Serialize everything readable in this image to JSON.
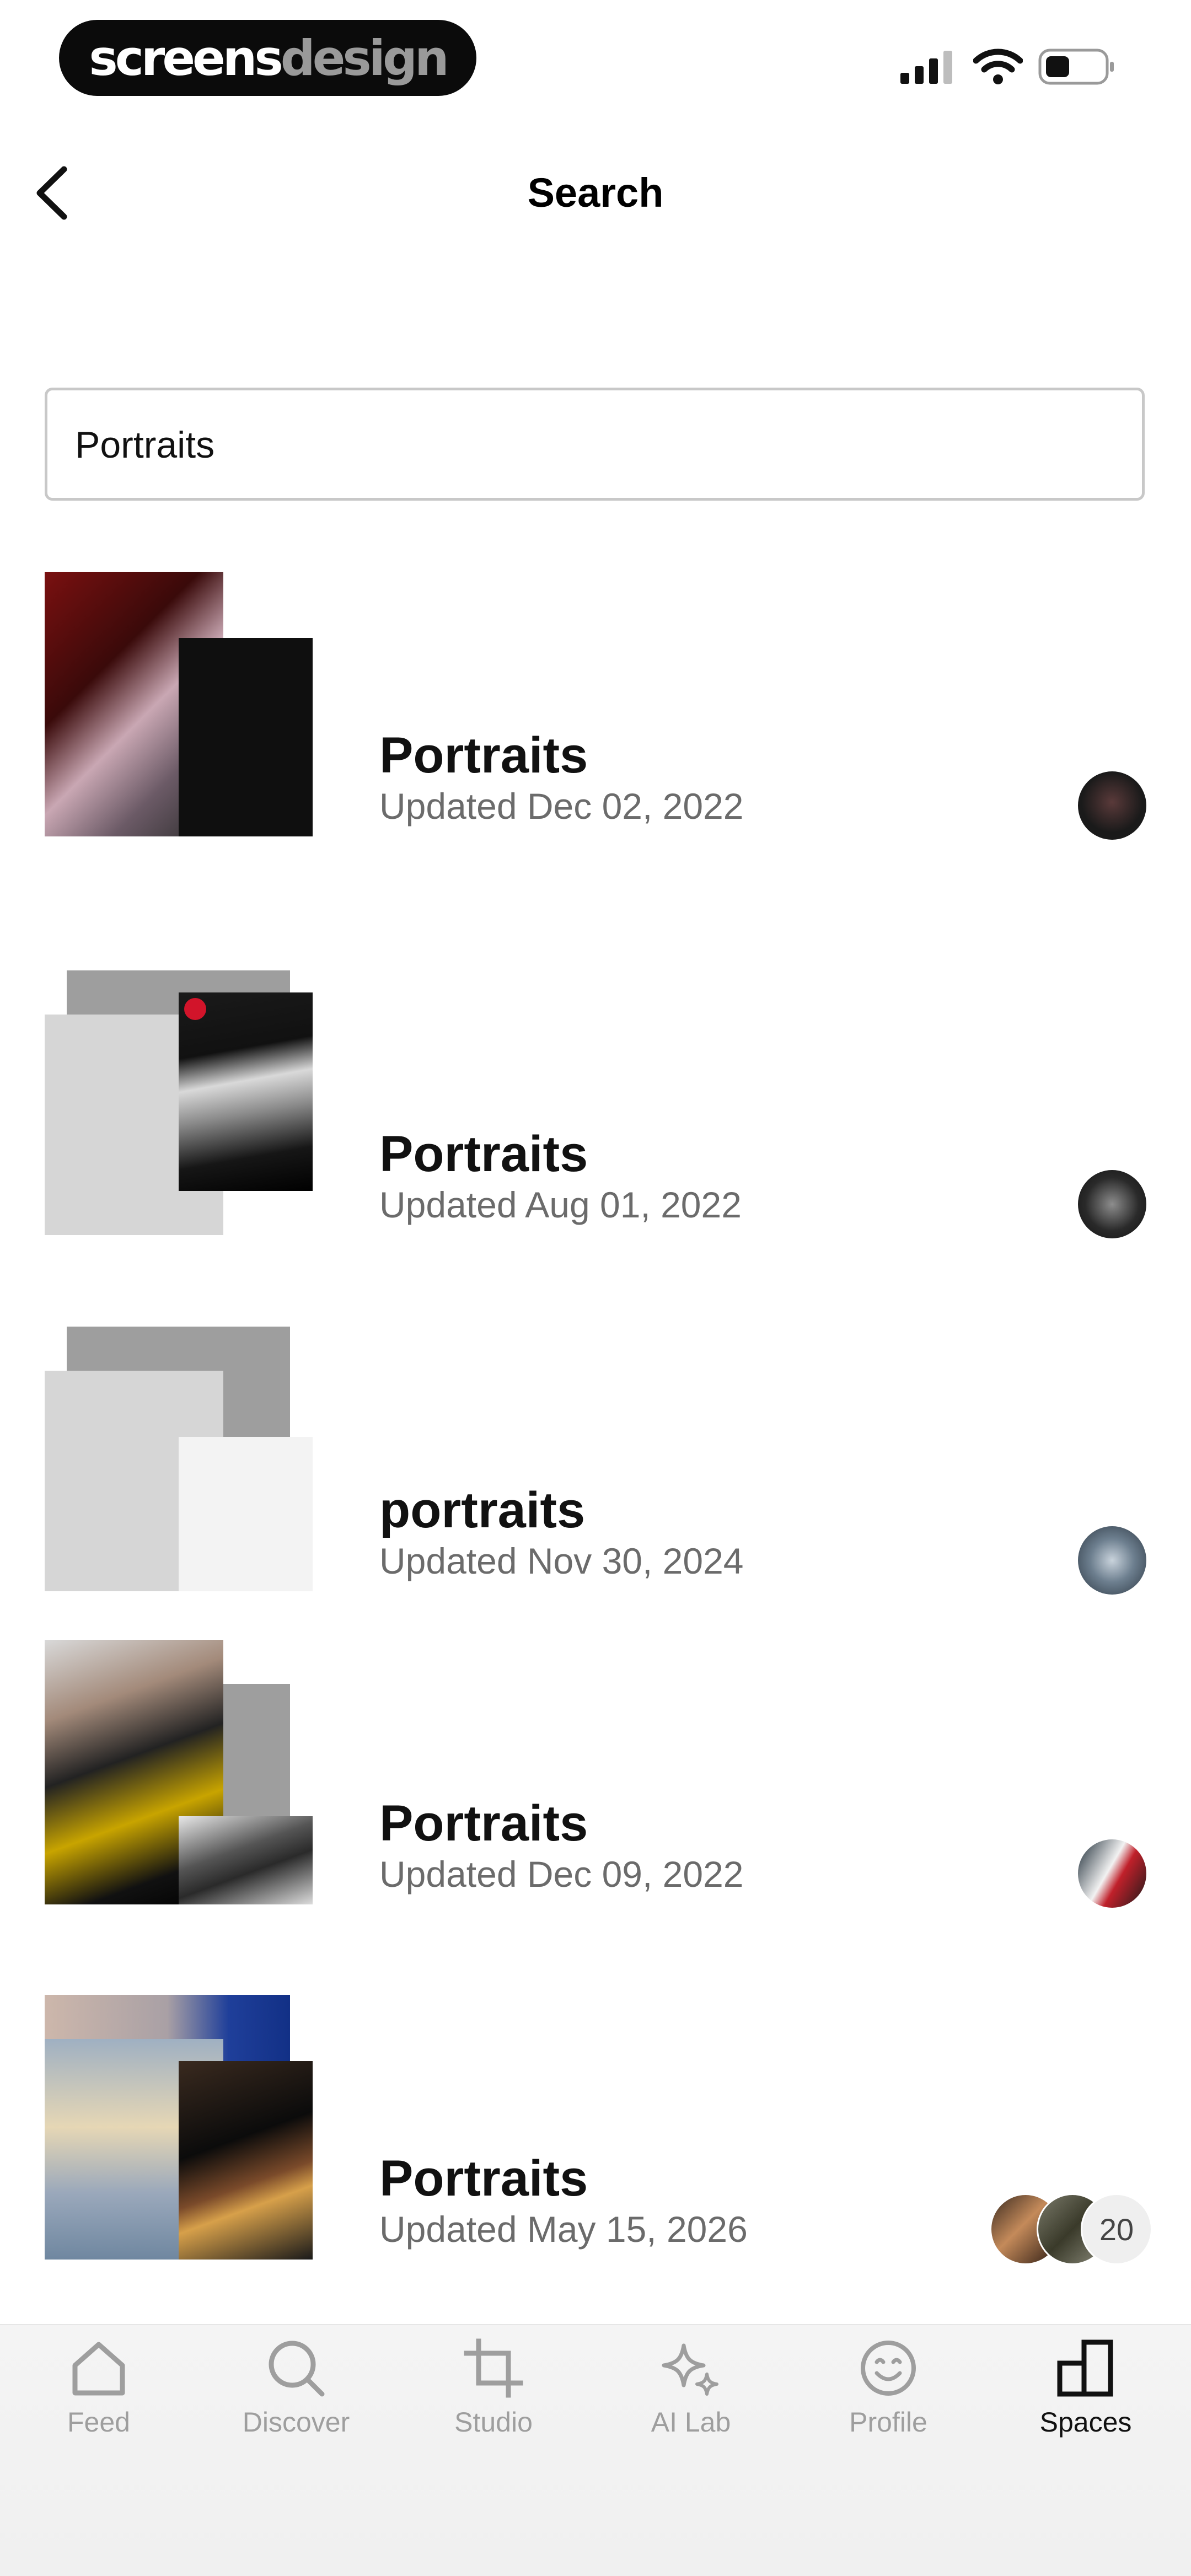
{
  "status_bar": {
    "brand_part1": "screens",
    "brand_part2": "design"
  },
  "header": {
    "title": "Search"
  },
  "search": {
    "value": "Portraits"
  },
  "results": [
    {
      "name": "Portraits",
      "updated": "Updated Dec 02, 2022"
    },
    {
      "name": "Portraits",
      "updated": "Updated Aug 01, 2022"
    },
    {
      "name": "portraits",
      "updated": "Updated Nov 30, 2024"
    },
    {
      "name": "Portraits",
      "updated": "Updated Dec 09, 2022"
    },
    {
      "name": "Portraits",
      "updated": "Updated May 15, 2026",
      "collaborator_count": "20"
    }
  ],
  "tabs": [
    {
      "label": "Feed",
      "icon": "home-icon"
    },
    {
      "label": "Discover",
      "icon": "search-icon"
    },
    {
      "label": "Studio",
      "icon": "crop-icon"
    },
    {
      "label": "AI Lab",
      "icon": "sparkle-icon"
    },
    {
      "label": "Profile",
      "icon": "smiley-icon"
    },
    {
      "label": "Spaces",
      "icon": "spaces-icon",
      "active": true
    }
  ],
  "colors": {
    "active_tab": "#111111",
    "inactive_tab": "#9e9e9e",
    "date_text": "#6b6b6b"
  }
}
